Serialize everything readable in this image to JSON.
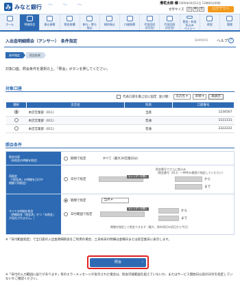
{
  "header": {
    "brand": "みなと銀行",
    "user_name": "港花太郎 様",
    "last_login": "2000年04月12日 12時00分00秒",
    "font_size_label": "文字サイズ",
    "font_small": "小",
    "font_mid": "中",
    "font_large": "大",
    "logout": "ログアウト"
  },
  "nav": [
    {
      "label": "ホーム"
    },
    {
      "label": "明細照会"
    },
    {
      "label": "振込振替"
    },
    {
      "label": "税金各種"
    },
    {
      "label": "給与・賞与\n振込"
    },
    {
      "label": "総合振込"
    },
    {
      "label": "口座振替"
    },
    {
      "label": "代金回収\n(2月目)"
    },
    {
      "label": "代金回収\n(3月目)"
    },
    {
      "label": "税金・料金\n払込み\nペイジー"
    },
    {
      "label": "承認"
    },
    {
      "label": "管理"
    }
  ],
  "page": {
    "title": "入出金明細照会（アンサー）　条件指定",
    "id": "BAMI001",
    "help": "ヘルプ",
    "help_mark": "?"
  },
  "steps": [
    "条件指定",
    "照会結果"
  ],
  "intro": "対象口座、照会条件を選択の上、「照会」ボタンを押してください。",
  "accounts": {
    "heading": "対象口座",
    "show_all": "代表口座を最上位に固定",
    "sort_label": "並び順：",
    "sort_value": "支店名",
    "order_value": "昇順",
    "sort_button": "再表示",
    "columns": [
      "選択",
      "支店名",
      "科目",
      "口座番号"
    ],
    "rows": [
      {
        "branch": "本店営業部（011）",
        "type": "当座",
        "number": "1234567",
        "selected": true
      },
      {
        "branch": "本店営業部（011）",
        "type": "普通",
        "number": "1111111",
        "selected": false
      },
      {
        "branch": "本店営業部（011）",
        "type": "普通",
        "number": "2222222",
        "selected": false
      }
    ]
  },
  "conditions": {
    "heading": "照会条件",
    "r1_label": "照会内容\n（未照会の明細を照会）",
    "r1_opt": "期間で指定",
    "r1_text": "すべて（最大30営業日分）",
    "r2_label": "再照会\n（「照会済」の明細を日付や\n期間で再照会）",
    "r2_opt": "日付で指定",
    "r2_hint": "照会番号でさらに絞込み\n（照会番号（011）～999)の範囲で指定してください）",
    "r2_tag1": "カレンダーを開く",
    "r2_from": "から",
    "r2_to": "まで",
    "r3_label": "すべての明細を照会\n（明細照会「照会済」かつ「未照会」\nが混在されません。）",
    "r3_opt1": "期間で指定",
    "r3_period": "当月",
    "r3_opt2": "日付範囲で指定",
    "r3_tag": "カレンダーを開く",
    "r3_from": "から",
    "r3_to": "まで",
    "r3_note": "期間を指定して照会できます（最大、前年同月の初日から今日）"
  },
  "note": "※「日付範囲指定」で全口座の入出金明細照会をご利用の場合、土日祝日の明細は金曜日または前営業日に表示します。",
  "submit": "照会",
  "submit_arrow": "›",
  "footer": "※「日付の入力範囲に誤りがあります」等のエラーメッセージが表示された場合は、照会可能範囲を超えていないか、またはサービス開始日以前の日付を指定していないかご確認ください。"
}
